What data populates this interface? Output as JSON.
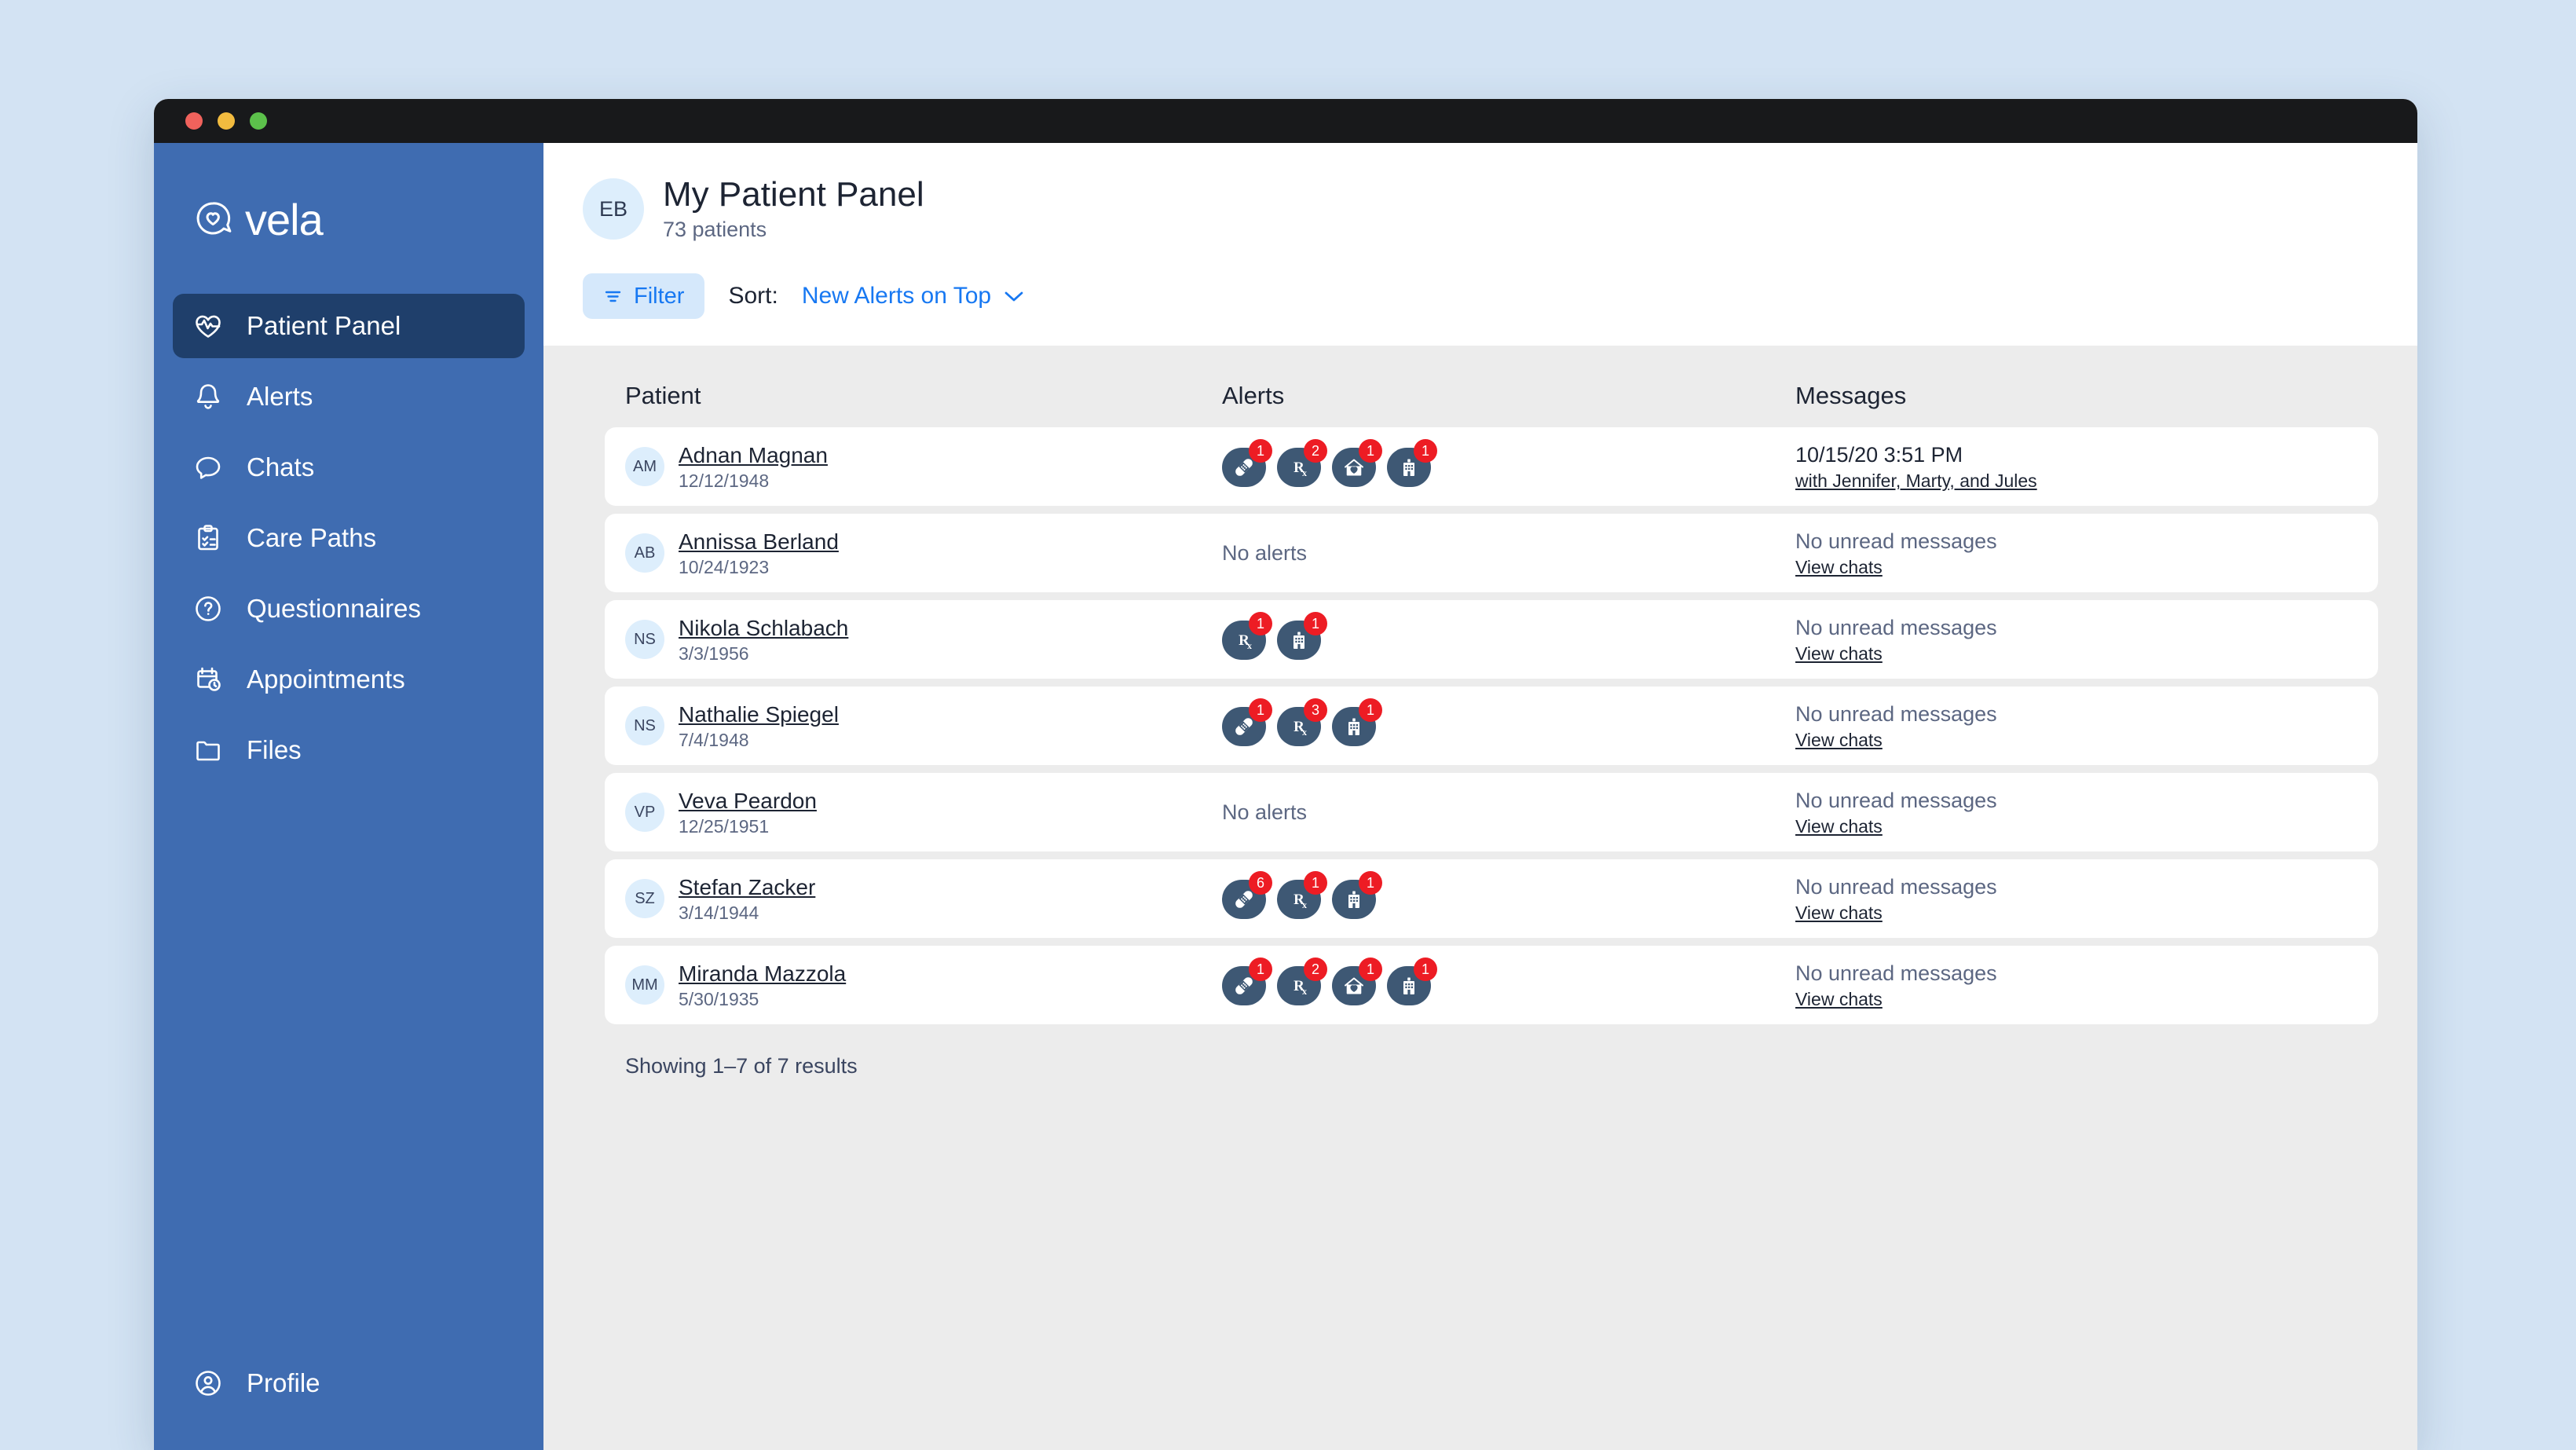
{
  "window": {
    "traffic_lights": [
      "close",
      "minimize",
      "maximize"
    ]
  },
  "brand": {
    "name": "vela",
    "logo_icon": "heart-chat-bubble-icon"
  },
  "sidebar": {
    "items": [
      {
        "label": "Patient Panel",
        "icon": "heart-pulse-icon",
        "active": true
      },
      {
        "label": "Alerts",
        "icon": "bell-icon",
        "active": false
      },
      {
        "label": "Chats",
        "icon": "chat-bubble-icon",
        "active": false
      },
      {
        "label": "Care Paths",
        "icon": "clipboard-check-icon",
        "active": false
      },
      {
        "label": "Questionnaires",
        "icon": "question-circle-icon",
        "active": false
      },
      {
        "label": "Appointments",
        "icon": "calendar-clock-icon",
        "active": false
      },
      {
        "label": "Files",
        "icon": "folder-icon",
        "active": false
      }
    ],
    "profile": {
      "label": "Profile",
      "icon": "user-circle-icon"
    }
  },
  "header": {
    "avatar_initials": "EB",
    "title": "My Patient Panel",
    "subtitle": "73 patients"
  },
  "toolbar": {
    "filter_label": "Filter",
    "filter_icon": "filter-lines-icon",
    "sort_label": "Sort:",
    "sort_value": "New Alerts on Top",
    "sort_chevron_icon": "chevron-down-icon"
  },
  "table": {
    "columns": [
      "Patient",
      "Alerts",
      "Messages"
    ],
    "no_alerts_text": "No alerts",
    "no_unread_text": "No unread messages",
    "view_chats_text": "View chats",
    "rows": [
      {
        "initials": "AM",
        "name": "Adnan Magnan",
        "dob": "12/12/1948",
        "alerts": [
          {
            "icon": "bandage-icon",
            "count": "1"
          },
          {
            "icon": "prescription-rx-icon",
            "count": "2"
          },
          {
            "icon": "home-heart-icon",
            "count": "1"
          },
          {
            "icon": "hospital-icon",
            "count": "1"
          }
        ],
        "message_primary": "10/15/20 3:51 PM",
        "message_link": "with Jennifer, Marty, and Jules",
        "message_muted": false
      },
      {
        "initials": "AB",
        "name": "Annissa Berland",
        "dob": "10/24/1923",
        "alerts": [],
        "message_primary": "No unread messages",
        "message_link": "View chats",
        "message_muted": true
      },
      {
        "initials": "NS",
        "name": "Nikola Schlabach",
        "dob": "3/3/1956",
        "alerts": [
          {
            "icon": "prescription-rx-icon",
            "count": "1"
          },
          {
            "icon": "hospital-icon",
            "count": "1"
          }
        ],
        "message_primary": "No unread messages",
        "message_link": "View chats",
        "message_muted": true
      },
      {
        "initials": "NS",
        "name": "Nathalie Spiegel",
        "dob": "7/4/1948",
        "alerts": [
          {
            "icon": "bandage-icon",
            "count": "1"
          },
          {
            "icon": "prescription-rx-icon",
            "count": "3"
          },
          {
            "icon": "hospital-icon",
            "count": "1"
          }
        ],
        "message_primary": "No unread messages",
        "message_link": "View chats",
        "message_muted": true
      },
      {
        "initials": "VP",
        "name": "Veva Peardon",
        "dob": "12/25/1951",
        "alerts": [],
        "message_primary": "No unread messages",
        "message_link": "View chats",
        "message_muted": true
      },
      {
        "initials": "SZ",
        "name": "Stefan Zacker",
        "dob": "3/14/1944",
        "alerts": [
          {
            "icon": "bandage-icon",
            "count": "6"
          },
          {
            "icon": "prescription-rx-icon",
            "count": "1"
          },
          {
            "icon": "hospital-icon",
            "count": "1"
          }
        ],
        "message_primary": "No unread messages",
        "message_link": "View chats",
        "message_muted": true
      },
      {
        "initials": "MM",
        "name": "Miranda Mazzola",
        "dob": "5/30/1935",
        "alerts": [
          {
            "icon": "bandage-icon",
            "count": "1"
          },
          {
            "icon": "prescription-rx-icon",
            "count": "2"
          },
          {
            "icon": "home-heart-icon",
            "count": "1"
          },
          {
            "icon": "hospital-icon",
            "count": "1"
          }
        ],
        "message_primary": "No unread messages",
        "message_link": "View chats",
        "message_muted": true
      }
    ],
    "results_text": "Showing 1–7 of 7 results"
  },
  "colors": {
    "page_background": "#d3e3f3",
    "sidebar": "#3f6cb1",
    "sidebar_active": "#1f3f6b",
    "titlebar": "#18191b",
    "content_background": "#ececec",
    "accent_link": "#1778f2",
    "filter_chip": "#d5e8fb",
    "alert_pill": "#3e5874",
    "alert_count": "#ed1c24",
    "avatar": "#ddeefc"
  }
}
